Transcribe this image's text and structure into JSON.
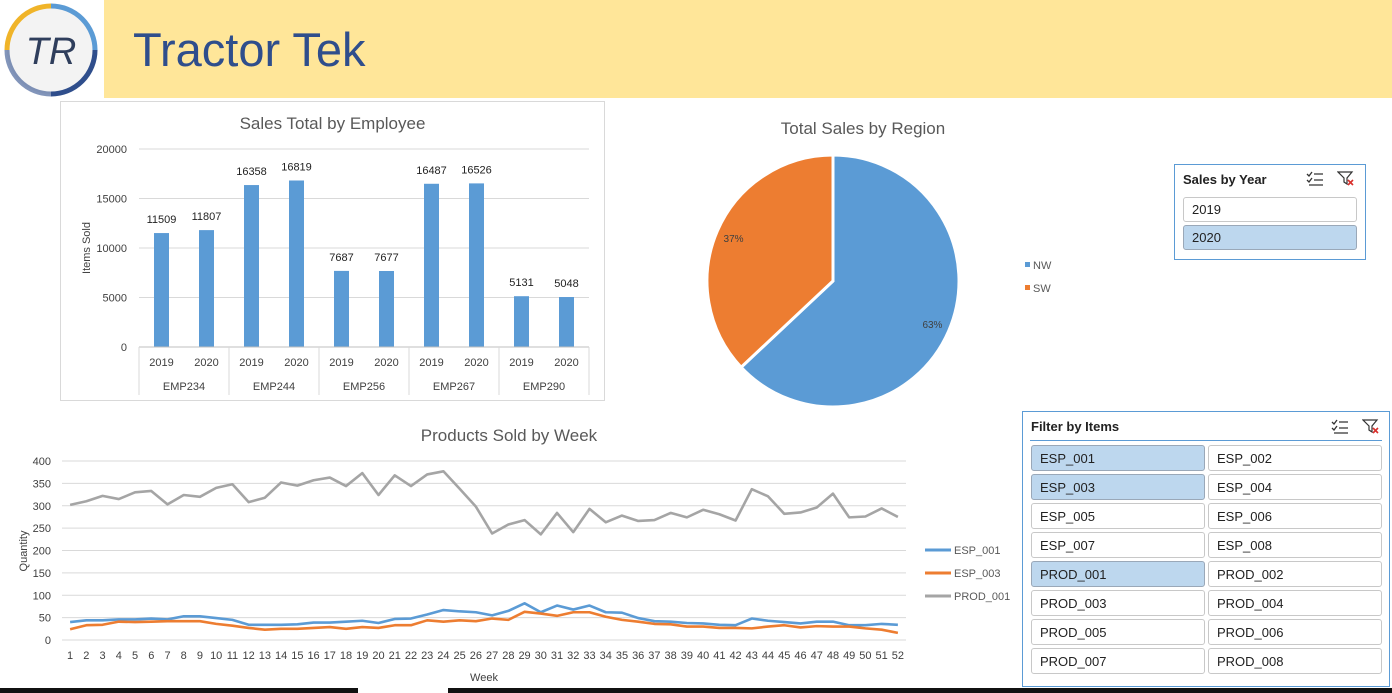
{
  "header": {
    "title": "Tractor Tek",
    "logo_text": "TR"
  },
  "colors": {
    "blue": "#5b9bd5",
    "orange": "#ed7d31",
    "gray": "#a5a5a5",
    "header_bg": "#ffe699",
    "title": "#2f4e8c",
    "selected": "#bdd7ee"
  },
  "chart_data": [
    {
      "type": "bar",
      "title": "Sales Total by Employee",
      "ylabel": "Items Sold",
      "xlabel": "",
      "ylim": [
        0,
        20000
      ],
      "yticks": [
        "0",
        "5000",
        "10000",
        "15000",
        "20000"
      ],
      "groups": [
        "EMP234",
        "EMP244",
        "EMP256",
        "EMP267",
        "EMP290"
      ],
      "categories": [
        "2019",
        "2020",
        "2019",
        "2020",
        "2019",
        "2020",
        "2019",
        "2020",
        "2019",
        "2020"
      ],
      "values": [
        11509,
        11807,
        16358,
        16819,
        7687,
        7677,
        16487,
        16526,
        5131,
        5048
      ],
      "grid": true
    },
    {
      "type": "pie",
      "title": "Total Sales by Region",
      "labels": [
        "NW",
        "SW"
      ],
      "values": [
        63,
        37
      ],
      "value_labels": [
        "63%",
        "37%"
      ],
      "legend": "right"
    },
    {
      "type": "line",
      "title": "Products Sold by Week",
      "xlabel": "Week",
      "ylabel": "Quantity",
      "ylim": [
        0,
        400
      ],
      "yticks": [
        "0",
        "50",
        "100",
        "150",
        "200",
        "250",
        "300",
        "350",
        "400"
      ],
      "x": [
        "1",
        "2",
        "3",
        "4",
        "5",
        "6",
        "7",
        "8",
        "9",
        "10",
        "11",
        "12",
        "13",
        "14",
        "15",
        "16",
        "17",
        "18",
        "19",
        "20",
        "21",
        "22",
        "23",
        "24",
        "25",
        "26",
        "27",
        "28",
        "29",
        "30",
        "31",
        "32",
        "33",
        "34",
        "35",
        "36",
        "37",
        "38",
        "39",
        "40",
        "41",
        "42",
        "43",
        "44",
        "45",
        "46",
        "47",
        "48",
        "49",
        "50",
        "51",
        "52"
      ],
      "series": [
        {
          "name": "ESP_001",
          "values": [
            40,
            44,
            44,
            46,
            46,
            48,
            46,
            53,
            53,
            49,
            45,
            34,
            34,
            34,
            35,
            39,
            39,
            41,
            43,
            38,
            47,
            48,
            57,
            67,
            64,
            62,
            55,
            65,
            82,
            62,
            77,
            68,
            77,
            62,
            61,
            49,
            42,
            41,
            38,
            37,
            34,
            33,
            48,
            43,
            40,
            37,
            41,
            41,
            33,
            33,
            36,
            34
          ]
        },
        {
          "name": "ESP_003",
          "values": [
            24,
            33,
            34,
            41,
            40,
            41,
            42,
            42,
            42,
            36,
            32,
            27,
            23,
            25,
            25,
            27,
            29,
            25,
            29,
            27,
            33,
            33,
            44,
            41,
            44,
            42,
            48,
            45,
            63,
            59,
            54,
            62,
            62,
            52,
            45,
            41,
            36,
            35,
            30,
            30,
            27,
            27,
            26,
            30,
            33,
            28,
            31,
            30,
            30,
            26,
            23,
            16
          ]
        },
        {
          "name": "PROD_001",
          "values": [
            302,
            310,
            322,
            315,
            330,
            333,
            303,
            324,
            320,
            340,
            348,
            308,
            318,
            352,
            345,
            357,
            363,
            344,
            373,
            324,
            368,
            344,
            370,
            377,
            338,
            298,
            238,
            258,
            268,
            236,
            284,
            241,
            293,
            263,
            278,
            266,
            268,
            284,
            274,
            291,
            281,
            267,
            337,
            321,
            282,
            285,
            296,
            327,
            274,
            276,
            294,
            275
          ]
        }
      ],
      "legend": "right",
      "grid": true
    }
  ],
  "slicers": {
    "year": {
      "title": "Sales by Year",
      "items": [
        {
          "label": "2019",
          "selected": false
        },
        {
          "label": "2020",
          "selected": true
        }
      ]
    },
    "items": {
      "title": "Filter by  Items",
      "items": [
        {
          "label": "ESP_001",
          "selected": true
        },
        {
          "label": "ESP_002",
          "selected": false
        },
        {
          "label": "ESP_003",
          "selected": true
        },
        {
          "label": "ESP_004",
          "selected": false
        },
        {
          "label": "ESP_005",
          "selected": false
        },
        {
          "label": "ESP_006",
          "selected": false
        },
        {
          "label": "ESP_007",
          "selected": false
        },
        {
          "label": "ESP_008",
          "selected": false
        },
        {
          "label": "PROD_001",
          "selected": true
        },
        {
          "label": "PROD_002",
          "selected": false
        },
        {
          "label": "PROD_003",
          "selected": false
        },
        {
          "label": "PROD_004",
          "selected": false
        },
        {
          "label": "PROD_005",
          "selected": false
        },
        {
          "label": "PROD_006",
          "selected": false
        },
        {
          "label": "PROD_007",
          "selected": false
        },
        {
          "label": "PROD_008",
          "selected": false
        }
      ]
    }
  }
}
